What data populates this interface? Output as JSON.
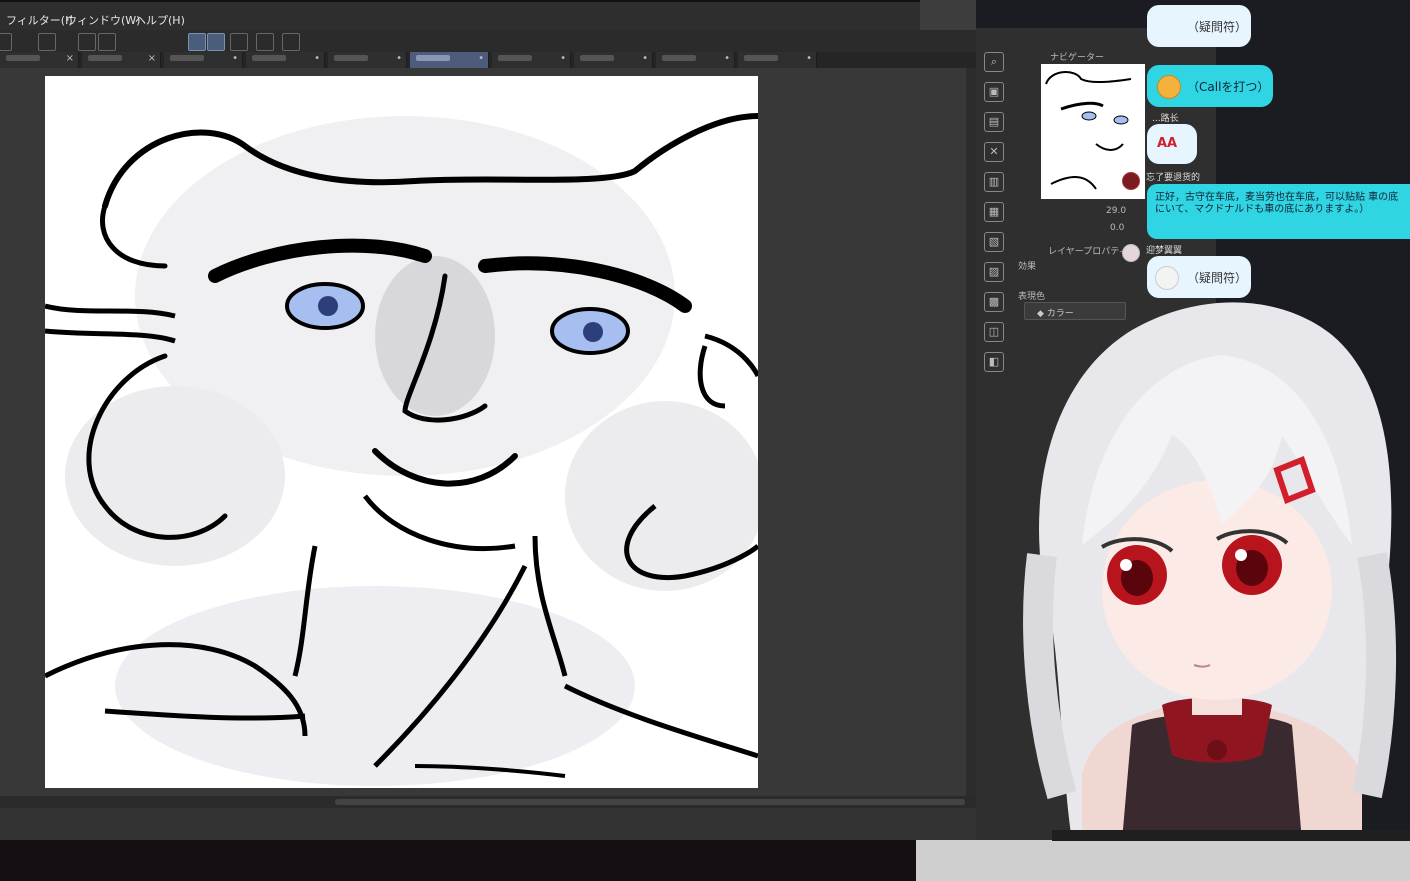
{
  "menu": {
    "filter": "フィルター(I)",
    "window": "ウィンドウ(W)",
    "help": "ヘルプ(H)"
  },
  "right_panel": {
    "navigator_label": "ナビゲーター",
    "zoom_value": "29.0",
    "angle_value": "0.0",
    "layer_property_label": "レイヤープロパティ",
    "effect_label": "効果",
    "expression_color_label": "表現色",
    "color_button": "カラー"
  },
  "chat": {
    "messages": [
      {
        "text": "（疑問符）"
      },
      {
        "text": "（Callを打つ）"
      },
      {
        "user": "...路长",
        "text": "AA"
      },
      {
        "user": "忘了要退货的",
        "text": "正好，古守在车底，麦当劳也在车底，可以贴贴 車の底にいて、マクドナルドも車の底にありますよ。）"
      },
      {
        "user": "迎梦翼翼",
        "text": "（疑問符）"
      }
    ]
  },
  "colors": {
    "app_bg": "#3d3d3d",
    "accent_tab": "#4d5c7d",
    "chat_light": "#e7f5ff",
    "chat_cyan": "#2fd5e3",
    "eye_blue": "#a7bff0",
    "vtuber_red": "#d21f2b"
  }
}
